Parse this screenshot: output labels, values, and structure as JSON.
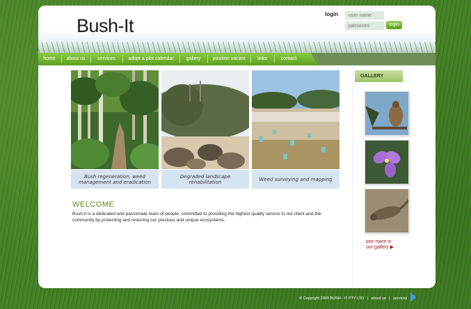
{
  "header": {
    "logo": "Bush-It",
    "login_label": "login",
    "username_placeholder": "user name",
    "password_placeholder": "password",
    "login_button": "login"
  },
  "nav": {
    "items": [
      "home",
      "about us",
      "services",
      "adopt a plot calendar",
      "gallery",
      "position vacant",
      "links",
      "contact"
    ]
  },
  "photos": [
    {
      "caption": "Bush regeneration, weed management and eradication"
    },
    {
      "caption": "Degraded landscape rehabilitation"
    },
    {
      "caption": "Weed surveying and mapping"
    }
  ],
  "welcome": {
    "title": "WELCOME",
    "text": "Bush-it is a dedicated and passionate team of people, committed to providing the highest quality service to our client and the community by protecting and restoring our precious and unique ecosystems."
  },
  "sidebar": {
    "title": "GALLERY",
    "thumbs": [
      "bird-photo",
      "flower-photo",
      "lizard-photo"
    ],
    "see_more_line1": "see more in",
    "see_more_line2": "our gallery"
  },
  "footer": {
    "copyright": "© Copyright 2009  BUSH - IT PTY LTD",
    "sep1": "|",
    "about": "about us",
    "sep2": "|",
    "services": "services"
  },
  "colors": {
    "nav_green": "#6db52c",
    "welcome_green": "#5c8a1f",
    "caption_bg": "#d6e3f1",
    "see_more_red": "#a01818"
  }
}
